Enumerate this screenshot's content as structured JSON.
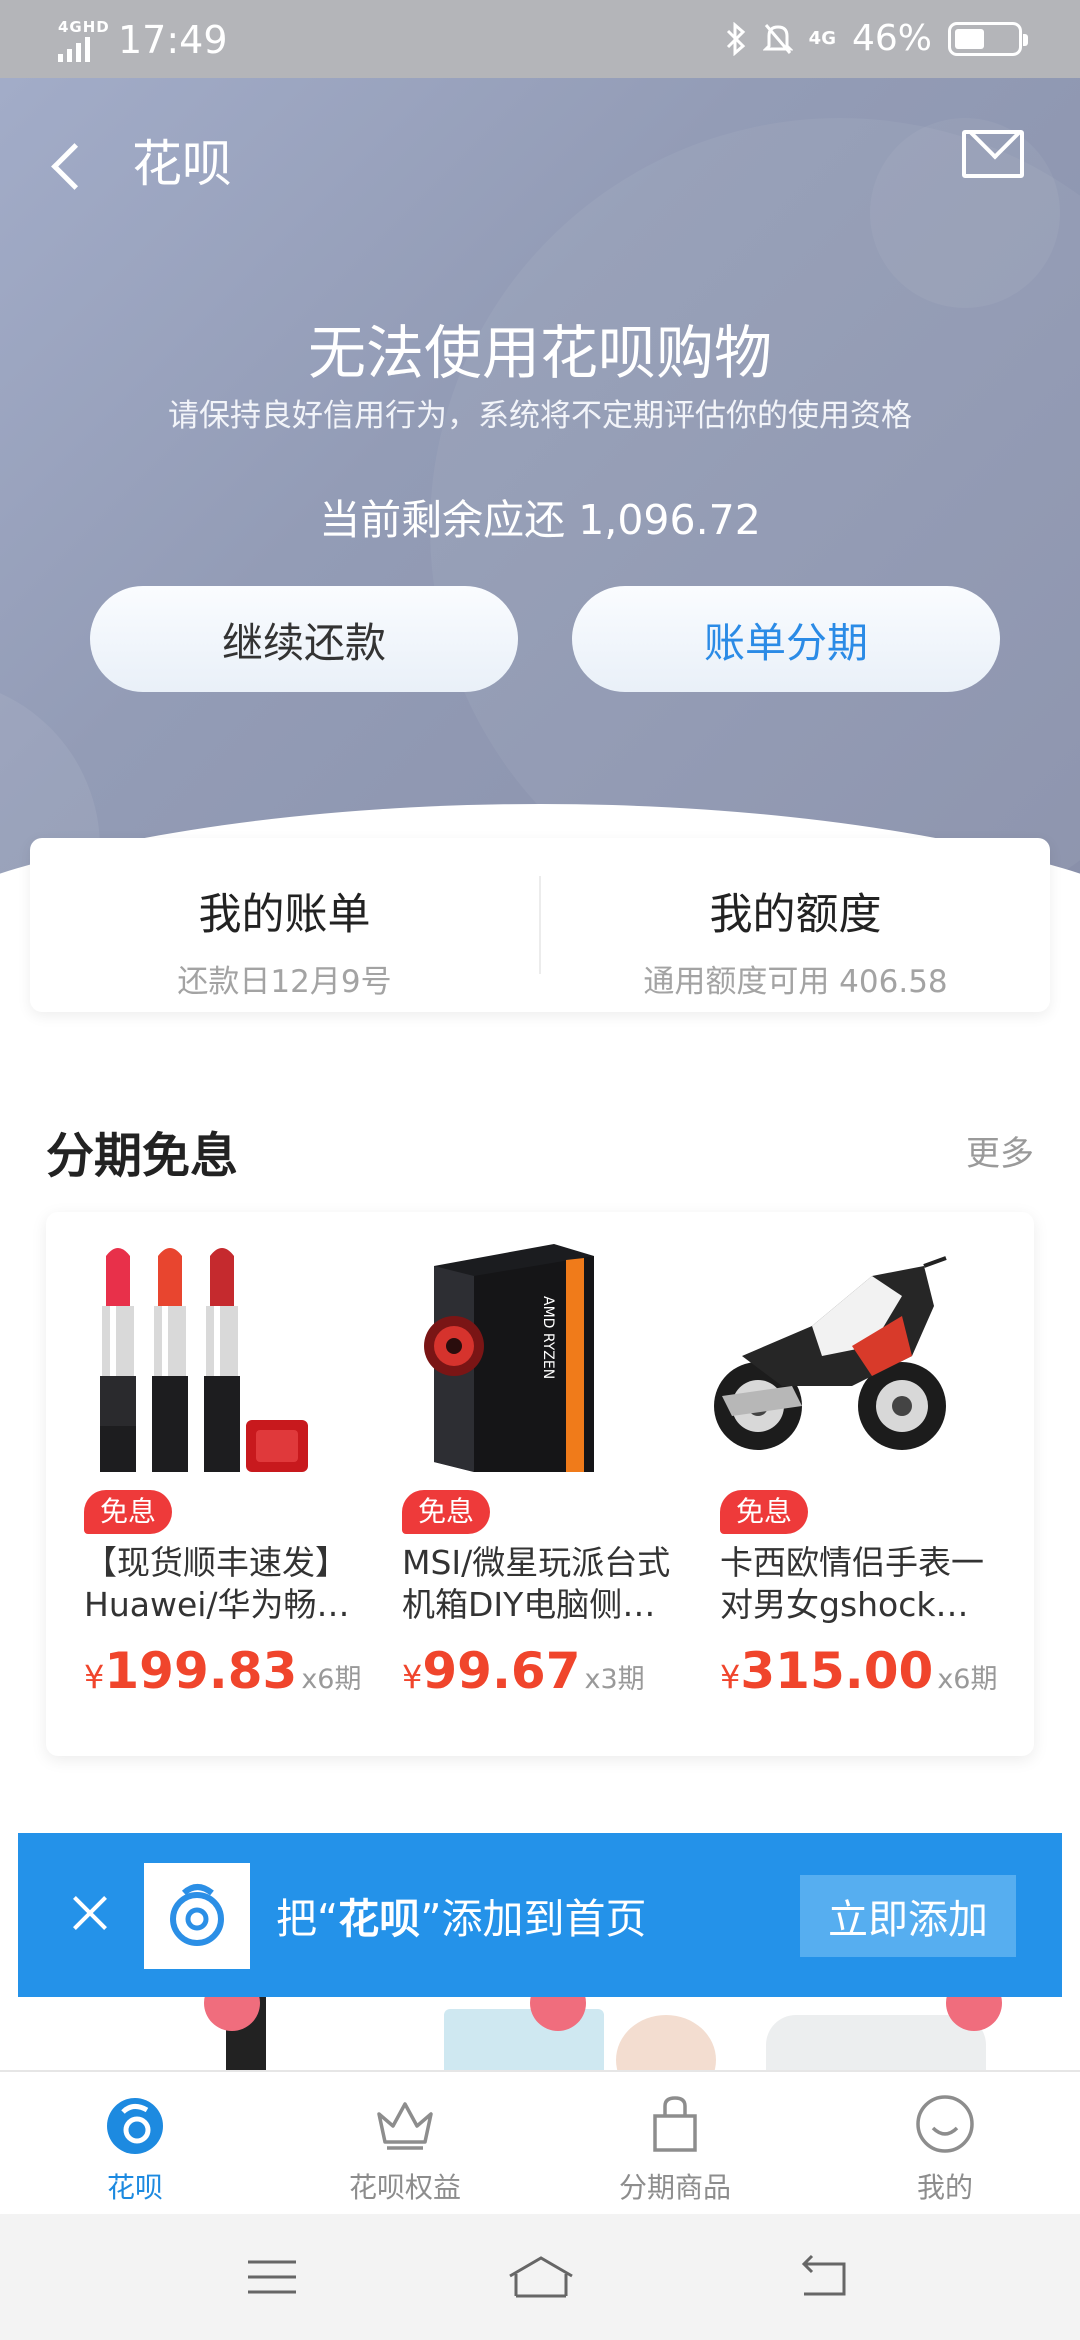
{
  "status_bar": {
    "network_tag": "4GHD",
    "time": "17:49",
    "bluetooth_icon": "bluetooth-icon",
    "mute_icon": "bell-off-icon",
    "network_type": "4G",
    "battery_percent": "46%",
    "battery_level": 0.46
  },
  "header": {
    "title": "花呗",
    "main_message": "无法使用花呗购物",
    "sub_message": "请保持良好信用行为，系统将不定期评估你的使用资格",
    "remaining_label": "当前剩余应还 1,096.72",
    "btn_repay": "继续还款",
    "btn_installment": "账单分期",
    "gradient_start": "#a2acc8",
    "gradient_end": "#8990aa"
  },
  "summary": {
    "bill_title": "我的账单",
    "bill_sub": "还款日12月9号",
    "quota_title": "我的额度",
    "quota_sub": "通用额度可用 406.58"
  },
  "section": {
    "title": "分期免息",
    "more": "更多"
  },
  "products": [
    {
      "badge": "免息",
      "name_line1": "【现货顺丰速发】",
      "name_line2": "Huawei/华为畅…",
      "currency": "¥",
      "price": "199.83",
      "period": "x6期",
      "icon": "lipstick-image"
    },
    {
      "badge": "免息",
      "name_line1": "MSI/微星玩派台式",
      "name_line2": "机箱DIY电脑侧透…",
      "currency": "¥",
      "price": "99.67",
      "period": "x3期",
      "icon": "pc-case-image"
    },
    {
      "badge": "免息",
      "name_line1": "卡西欧情侣手表一",
      "name_line2": "对男女gshock限…",
      "currency": "¥",
      "price": "315.00",
      "period": "x6期",
      "icon": "motorcycle-image"
    }
  ],
  "banner": {
    "text_prefix": "把“",
    "text_app": "花呗",
    "text_suffix": "”添加到首页",
    "add_button": "立即添加"
  },
  "bottom_nav": [
    {
      "label": "花呗",
      "icon": "huabei-icon",
      "active": true
    },
    {
      "label": "花呗权益",
      "icon": "crown-icon",
      "active": false
    },
    {
      "label": "分期商品",
      "icon": "shopping-bag-icon",
      "active": false
    },
    {
      "label": "我的",
      "icon": "smiley-icon",
      "active": false
    }
  ],
  "colors": {
    "accent_blue": "#2492e9",
    "price_red": "#f0452c",
    "badge_red": "#ee3a3a",
    "nav_active": "#1d8ae0"
  }
}
